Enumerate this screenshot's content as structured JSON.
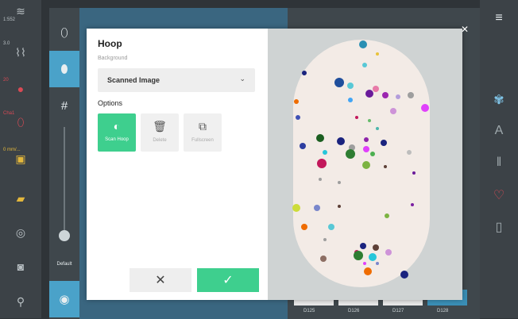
{
  "status_bar": {
    "items": [
      {
        "label": "1:552",
        "icon": "signal-icon"
      },
      {
        "label": "3.0",
        "icon": "stitch-length-icon"
      },
      {
        "label": "20",
        "icon": "tension-icon"
      },
      {
        "label": "Cha1",
        "icon": "presser-foot-icon"
      },
      {
        "label": "0 mm/...",
        "icon": "needle-position-icon"
      },
      {
        "label": "",
        "icon": "feed-dog-icon"
      },
      {
        "label": "",
        "icon": "target-icon"
      },
      {
        "label": "",
        "icon": "camera-icon"
      },
      {
        "label": "",
        "icon": "thread-icon"
      }
    ]
  },
  "toolbar": {
    "default_label": "Default"
  },
  "thumbnails": {
    "labels": [
      "D125",
      "D126",
      "D127",
      "D128"
    ]
  },
  "modal": {
    "title": "Hoop",
    "background_label": "Background",
    "selected_background": "Scanned Image",
    "options_label": "Options",
    "options": [
      {
        "label": "Scan Hoop",
        "icon": "scan-hoop-icon",
        "active": true
      },
      {
        "label": "Delete",
        "icon": "trash-icon",
        "active": false
      },
      {
        "label": "Fullscreen",
        "icon": "fullscreen-icon",
        "active": false
      }
    ],
    "cancel_symbol": "✕",
    "confirm_symbol": "✓"
  },
  "colors": {
    "accent": "#3ecf8e",
    "cancel_bg": "#eeeeee",
    "modal_bg": "#ffffff",
    "preview_bg": "#cfd3d3",
    "hoop_fill": "#f3ebe6"
  }
}
